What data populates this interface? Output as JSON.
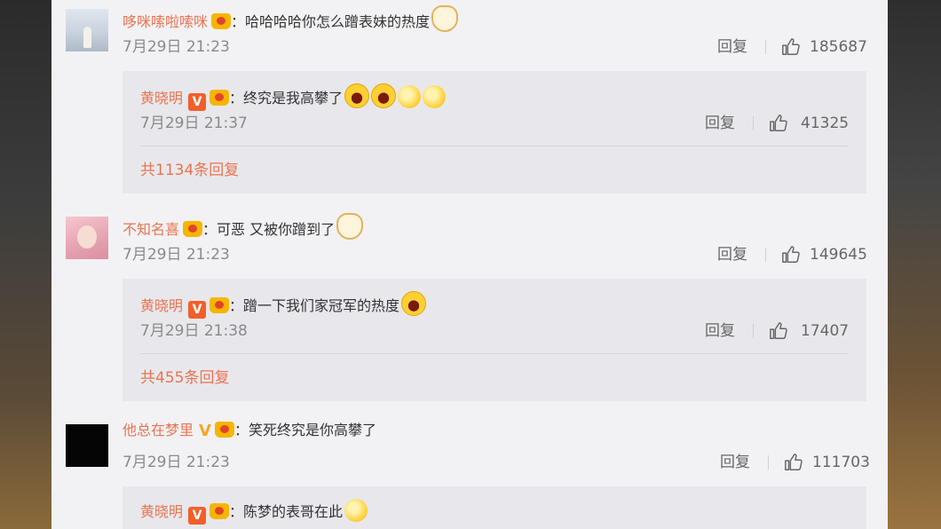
{
  "comments": [
    {
      "username": "哆咪嗦啦嗦咪",
      "text": "：哈哈哈哈你怎么蹭表妹的热度",
      "time": "7月29日 21:23",
      "reply_label": "回复",
      "likes": "185687",
      "reply": {
        "username": "黄晓明",
        "verified": "V",
        "text": "：终究是我高攀了",
        "time": "7月29日 21:37",
        "reply_label": "回复",
        "likes": "41325",
        "more": "共1134条回复"
      }
    },
    {
      "username": "不知名喜",
      "text": "：可恶 又被你蹭到了",
      "time": "7月29日 21:23",
      "reply_label": "回复",
      "likes": "149645",
      "reply": {
        "username": "黄晓明",
        "verified": "V",
        "text": "：蹭一下我们家冠军的热度",
        "time": "7月29日 21:38",
        "reply_label": "回复",
        "likes": "17407",
        "more": "共455条回复"
      }
    },
    {
      "username": "他总在梦里",
      "verified": "V",
      "text": "：笑死终究是你高攀了",
      "time": "7月29日 21:23",
      "reply_label": "回复",
      "likes": "111703",
      "reply": {
        "username": "黄晓明",
        "verified": "V",
        "text": "：陈梦的表哥在此"
      }
    }
  ],
  "icons": {
    "like": "thumbs-up-icon",
    "vip": "crown-icon",
    "verified": "verified-v-icon"
  },
  "colors": {
    "username": "#eb7350",
    "panel_bg": "#f2f2f5",
    "reply_bg": "#e8e8ec",
    "meta_text": "#8a8a8a"
  }
}
